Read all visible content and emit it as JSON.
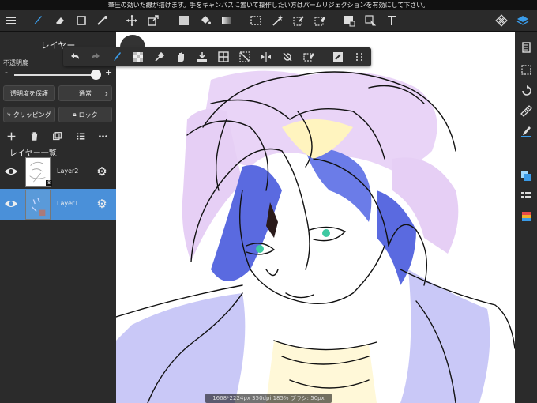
{
  "hint": "筆圧の効いた線が描けます。手をキャンバスに置いて操作したい方はパームリジェクションを有効にして下さい。",
  "panel": {
    "title": "レイヤー",
    "opacity_label": "不透明度",
    "minus": "-",
    "plus": "+",
    "protect_label": "透明度を保護",
    "blend_label": "通常",
    "blend_arrow": "›",
    "clipping_label": "クリッピング",
    "lock_label": "ロック",
    "list_title": "レイヤー一覧",
    "opacity_value": 1.0,
    "layers": [
      {
        "name": "Layer2",
        "badge": "8",
        "visible": true,
        "selected": false
      },
      {
        "name": "Layer1",
        "badge": "",
        "visible": true,
        "selected": true
      }
    ]
  },
  "status_text": "1668*2224px 350dpi 185%  ブラシ: 50px 100%",
  "colors": {
    "accent": "#3a9be8",
    "selected_layer": "#4a90d9",
    "panel_bg": "#2b2b2b",
    "toolbar_bg": "#2a2a2a"
  },
  "icons": {
    "top": [
      "menu-icon",
      "brush-icon",
      "eraser-icon",
      "square-icon",
      "magic-pen-icon",
      "move-icon",
      "transform-icon",
      "fill-color-icon",
      "bucket-icon",
      "gradient-icon",
      "select-rect-icon",
      "magic-wand-icon",
      "select-pen-icon",
      "select-eraser-icon",
      "lasso-fill-icon",
      "select-move-icon",
      "text-icon",
      "materials-icon",
      "layers-icon"
    ],
    "quick": [
      "undo-icon",
      "redo-icon",
      "brush-mode-icon",
      "transparent-icon",
      "eyedropper-icon",
      "hand-icon",
      "import-icon",
      "grid-icon",
      "deselect-icon",
      "flip-icon",
      "rotate-off-icon",
      "clear-icon",
      "fill-icon",
      "more-icon"
    ],
    "right": [
      "pages-icon",
      "selection-icon",
      "rotate-icon",
      "ruler-icon",
      "pen-color-icon",
      "copy-icon",
      "layer-properties-icon",
      "palette-icon"
    ]
  }
}
